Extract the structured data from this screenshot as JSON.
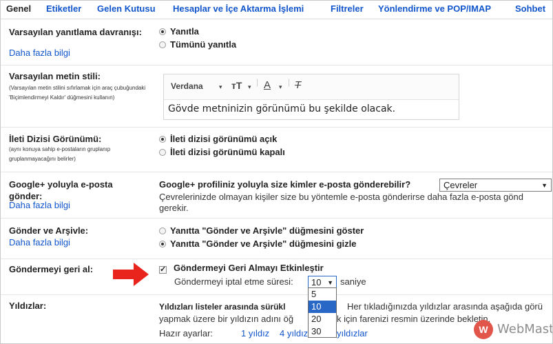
{
  "tabs": [
    "Genel",
    "Etiketler",
    "Gelen Kutusu",
    "Hesaplar ve İçe Aktarma İşlemi",
    "Filtreler",
    "Yönlendirme ve POP/IMAP",
    "Sohbet"
  ],
  "reply": {
    "label": "Varsayılan yanıtlama davranışı:",
    "link": "Daha fazla bilgi",
    "options": [
      "Yanıtla",
      "Tümünü yanıtla"
    ]
  },
  "textstyle": {
    "label": "Varsayılan metin stili:",
    "desc": "(Varsayılan metin stilini sıfırlamak için araç çubuğundaki 'Biçimlendirmeyi Kaldır' düğmesini kullanın)",
    "font": "Verdana",
    "sample": "Gövde metninizin görünümü bu şekilde olacak."
  },
  "conversation": {
    "label": "İleti Dizisi Görünümü:",
    "desc": "(aynı konuya sahip e-postaların gruplanıp gruplanmayacağını belirler)",
    "options": [
      "İleti dizisi görünümü açık",
      "İleti dizisi görünümü kapalı"
    ]
  },
  "gplus": {
    "label": "Google+ yoluyla e-posta gönder:",
    "link": "Daha fazla bilgi",
    "question": "Google+ profiliniz yoluyla size kimler e-posta gönderebilir?",
    "select": "Çevreler",
    "note": "Çevrelerinizde olmayan kişiler size bu yöntemle e-posta gönderirse daha fazla e-posta gönd gerekir."
  },
  "archive": {
    "label": "Gönder ve Arşivle:",
    "link": "Daha fazla bilgi",
    "options": [
      "Yanıtta \"Gönder ve Arşivle\" düğmesini göster",
      "Yanıtta \"Gönder ve Arşivle\" düğmesini gizle"
    ]
  },
  "undo": {
    "label": "Göndermeyi geri al:",
    "checkbox": "Göndermeyi Geri Almayı Etkinleştir",
    "period_label": "Göndermeyi iptal etme süresi:",
    "period_value": "10",
    "unit": "saniye",
    "dropdown": [
      "5",
      "10",
      "20",
      "30"
    ],
    "dropdown_selected": "10"
  },
  "stars": {
    "label": "Yıldızlar:",
    "line1a": "Yıldızları listeler arasında sürükl",
    "line1b": "Her tıkladığınızda yıldızlar arasında aşağıda görü",
    "line2a": "yapmak üzere bir yıldızın adını öğ",
    "line2b": "k için farenizi resmin üzerinde bekletin.",
    "presets_label": "Hazır ayarlar:",
    "preset1": "1 yıldız",
    "preset2": "4 yıldız",
    "preset3": "yıldızlar"
  },
  "watermark": "WebMasto"
}
